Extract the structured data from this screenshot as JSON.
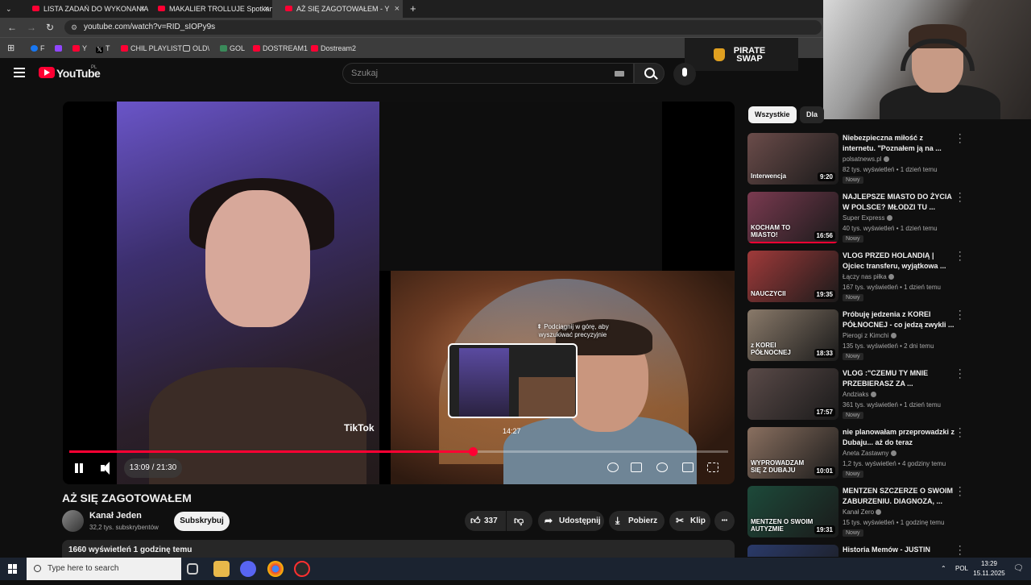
{
  "browser": {
    "tabs": [
      {
        "title": "LISTA ZADAŃ DO WYKONANIA"
      },
      {
        "title": "MAKALIER TROLLUJE Spotkanie"
      },
      {
        "title": "AŻ SIĘ ZAGOTOWAŁEM - Y"
      }
    ],
    "new_tab": "+",
    "close_glyph": "×",
    "url": "youtube.com/watch?v=RID_sIOPy9s",
    "bookmarks": [
      "F",
      "Y",
      "T",
      "CHIL PLAYLIST",
      "OLD\\",
      "GOL",
      "DOSTREAM1",
      "Dostream2"
    ]
  },
  "overlay": {
    "pirate_swap": "PIRATE SWAP"
  },
  "youtube": {
    "logo": "YouTube",
    "country": "PL",
    "search_placeholder": "Szukaj"
  },
  "player": {
    "tiktok_label": "TikTok",
    "seek_hint": "⇞ Podciągnij w górę, aby wyszukiwać precyzyjnie",
    "preview_time": "14:27",
    "time_display": "13:09 / 21:30",
    "progress": 0.613,
    "hover_position": 0.675
  },
  "video": {
    "title": "AŻ SIĘ ZAGOTOWAŁEM",
    "channel": "Kanał Jeden",
    "subscribers": "32,2 tys. subskrybentów",
    "subscribe_label": "Subskrybuj",
    "likes": "337",
    "share_label": "Udostępnij",
    "download_label": "Pobierz",
    "clip_label": "Klip",
    "more_glyph": "•••",
    "description_meta": "1660 wyświetleń  1 godzinę temu"
  },
  "sidebar": {
    "chips": [
      "Wszystkie",
      "Dla C"
    ],
    "badge_new": "Nowy",
    "recommendations": [
      {
        "title": "Niebezpieczna miłość z internetu. \"Poznałem ją na ...",
        "channel": "polsatnews.pl",
        "meta": "82 tys. wyświetleń • 1 dzień temu",
        "duration": "9:20",
        "thumb_text": "Interwencja",
        "thumb_color": "#6b4c4a",
        "watched": 0
      },
      {
        "title": "NAJLEPSZE MIASTO DO ŻYCIA W POLSCE? MŁODZI TU ...",
        "channel": "Super Express",
        "meta": "40 tys. wyświetleń • 1 dzień temu",
        "duration": "16:56",
        "thumb_text": "KOCHAM TO MIASTO!",
        "thumb_color": "#7a3a50",
        "watched": 1
      },
      {
        "title": "VLOG PRZED HOLANDIĄ | Ojciec transferu, wyjątkowa ...",
        "channel": "Łączy nas piłka",
        "meta": "167 tys. wyświetleń • 1 dzień temu",
        "duration": "19:35",
        "thumb_text": "NAUCZYCII",
        "thumb_color": "#a03a3a",
        "watched": 0
      },
      {
        "title": "Próbuję jedzenia z KOREI PÓŁNOCNEJ - co jedzą zwykli ...",
        "channel": "Pierogi z Kimchi",
        "meta": "135 tys. wyświetleń • 2 dni temu",
        "duration": "18:33",
        "thumb_text": "z KOREI PÓŁNOCNEJ",
        "thumb_color": "#8a7a6a",
        "watched": 0
      },
      {
        "title": "VLOG :\"CZEMU TY MNIE PRZEBIERASZ ZA ...",
        "channel": "Andziaks",
        "meta": "361 tys. wyświetleń • 1 dzień temu",
        "duration": "17:57",
        "thumb_text": "",
        "thumb_color": "#5a4a48",
        "watched": 0
      },
      {
        "title": "nie planowałam przeprowadzki z Dubaju... aż do teraz",
        "channel": "Aneta Zastawny",
        "meta": "1,2 tys. wyświetleń • 4 godziny temu",
        "duration": "10:01",
        "thumb_text": "WYPROWADZAM SIĘ Z DUBAJU",
        "thumb_color": "#8a7060",
        "watched": 0
      },
      {
        "title": "MENTZEN SZCZERZE O SWOIM ZABURZENIU. DIAGNOZA, ...",
        "channel": "Kanał Zero",
        "meta": "15 tys. wyświetleń • 1 godzinę temu",
        "duration": "19:31",
        "thumb_text": "MENTZEN O SWOIM AUTYZMIE",
        "thumb_color": "#1d4a3a",
        "watched": 0
      },
      {
        "title": "Historia Memów - JUSTIN",
        "channel": "",
        "meta": "",
        "duration": "",
        "thumb_text": "",
        "thumb_color": "#2a3a6a",
        "watched": 0
      }
    ]
  },
  "taskbar": {
    "search_placeholder": "Type here to search",
    "lang": "POL",
    "time": "13:29",
    "date": "15.11.2025"
  }
}
